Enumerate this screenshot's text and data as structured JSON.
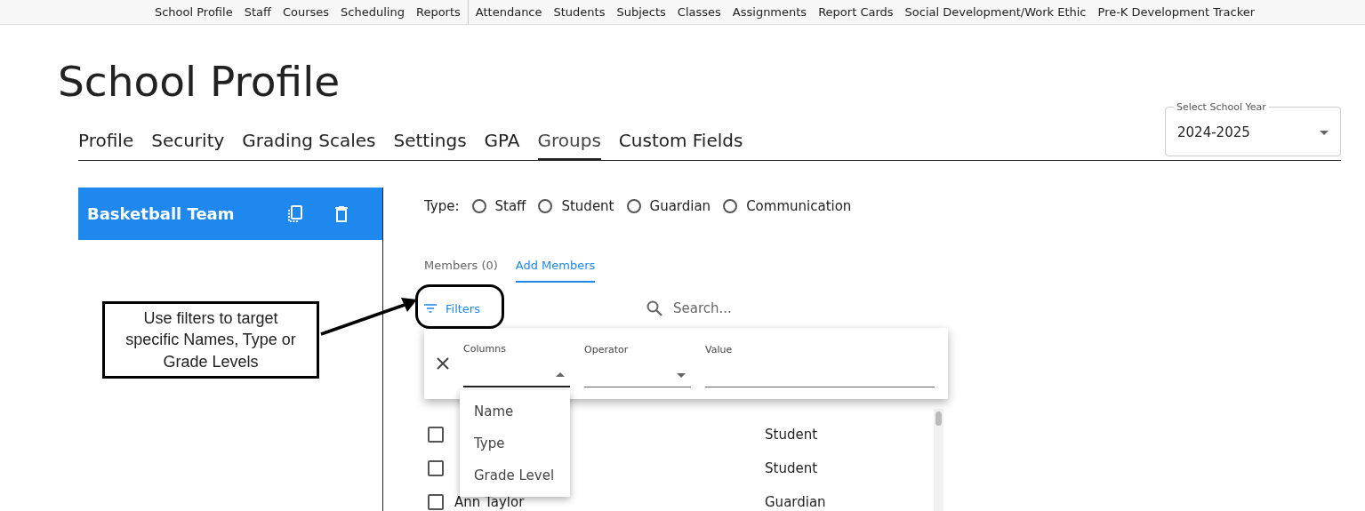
{
  "top_nav": {
    "groups": [
      [
        "School Profile",
        "Staff",
        "Courses",
        "Scheduling",
        "Reports"
      ],
      [
        "Attendance",
        "Students",
        "Subjects",
        "Classes",
        "Assignments",
        "Report Cards",
        "Social Development/Work Ethic",
        "Pre-K Development Tracker"
      ]
    ]
  },
  "page_title": "School Profile",
  "tabs": [
    {
      "label": "Profile",
      "selected": false
    },
    {
      "label": "Security",
      "selected": false
    },
    {
      "label": "Grading Scales",
      "selected": false
    },
    {
      "label": "Settings",
      "selected": false
    },
    {
      "label": "GPA",
      "selected": false
    },
    {
      "label": "Groups",
      "selected": true
    },
    {
      "label": "Custom Fields",
      "selected": false
    }
  ],
  "school_year": {
    "label": "Select School Year",
    "value": "2024-2025"
  },
  "groups": [
    {
      "name": "Basketball Team",
      "selected": true
    }
  ],
  "type_filter": {
    "label": "Type:",
    "options": [
      {
        "label": "Staff",
        "selected": false
      },
      {
        "label": "Student",
        "selected": false
      },
      {
        "label": "Guardian",
        "selected": false
      },
      {
        "label": "Communication",
        "selected": false
      }
    ]
  },
  "member_tabs": [
    {
      "label": "Members (0)",
      "selected": false
    },
    {
      "label": "Add Members",
      "selected": true
    }
  ],
  "filters_button": "Filters",
  "search": {
    "placeholder": "Search..."
  },
  "filter_panel": {
    "columns_label": "Columns",
    "operator_label": "Operator",
    "value_label": "Value",
    "columns_menu": [
      "Name",
      "Type",
      "Grade Level"
    ]
  },
  "rows": [
    {
      "type": "Student",
      "checked": false
    },
    {
      "type": "Student",
      "checked": false
    },
    {
      "name": "Ann Taylor",
      "type": "Guardian",
      "checked": false
    }
  ],
  "annotation": "Use filters to target specific Names, Type or Grade Levels"
}
